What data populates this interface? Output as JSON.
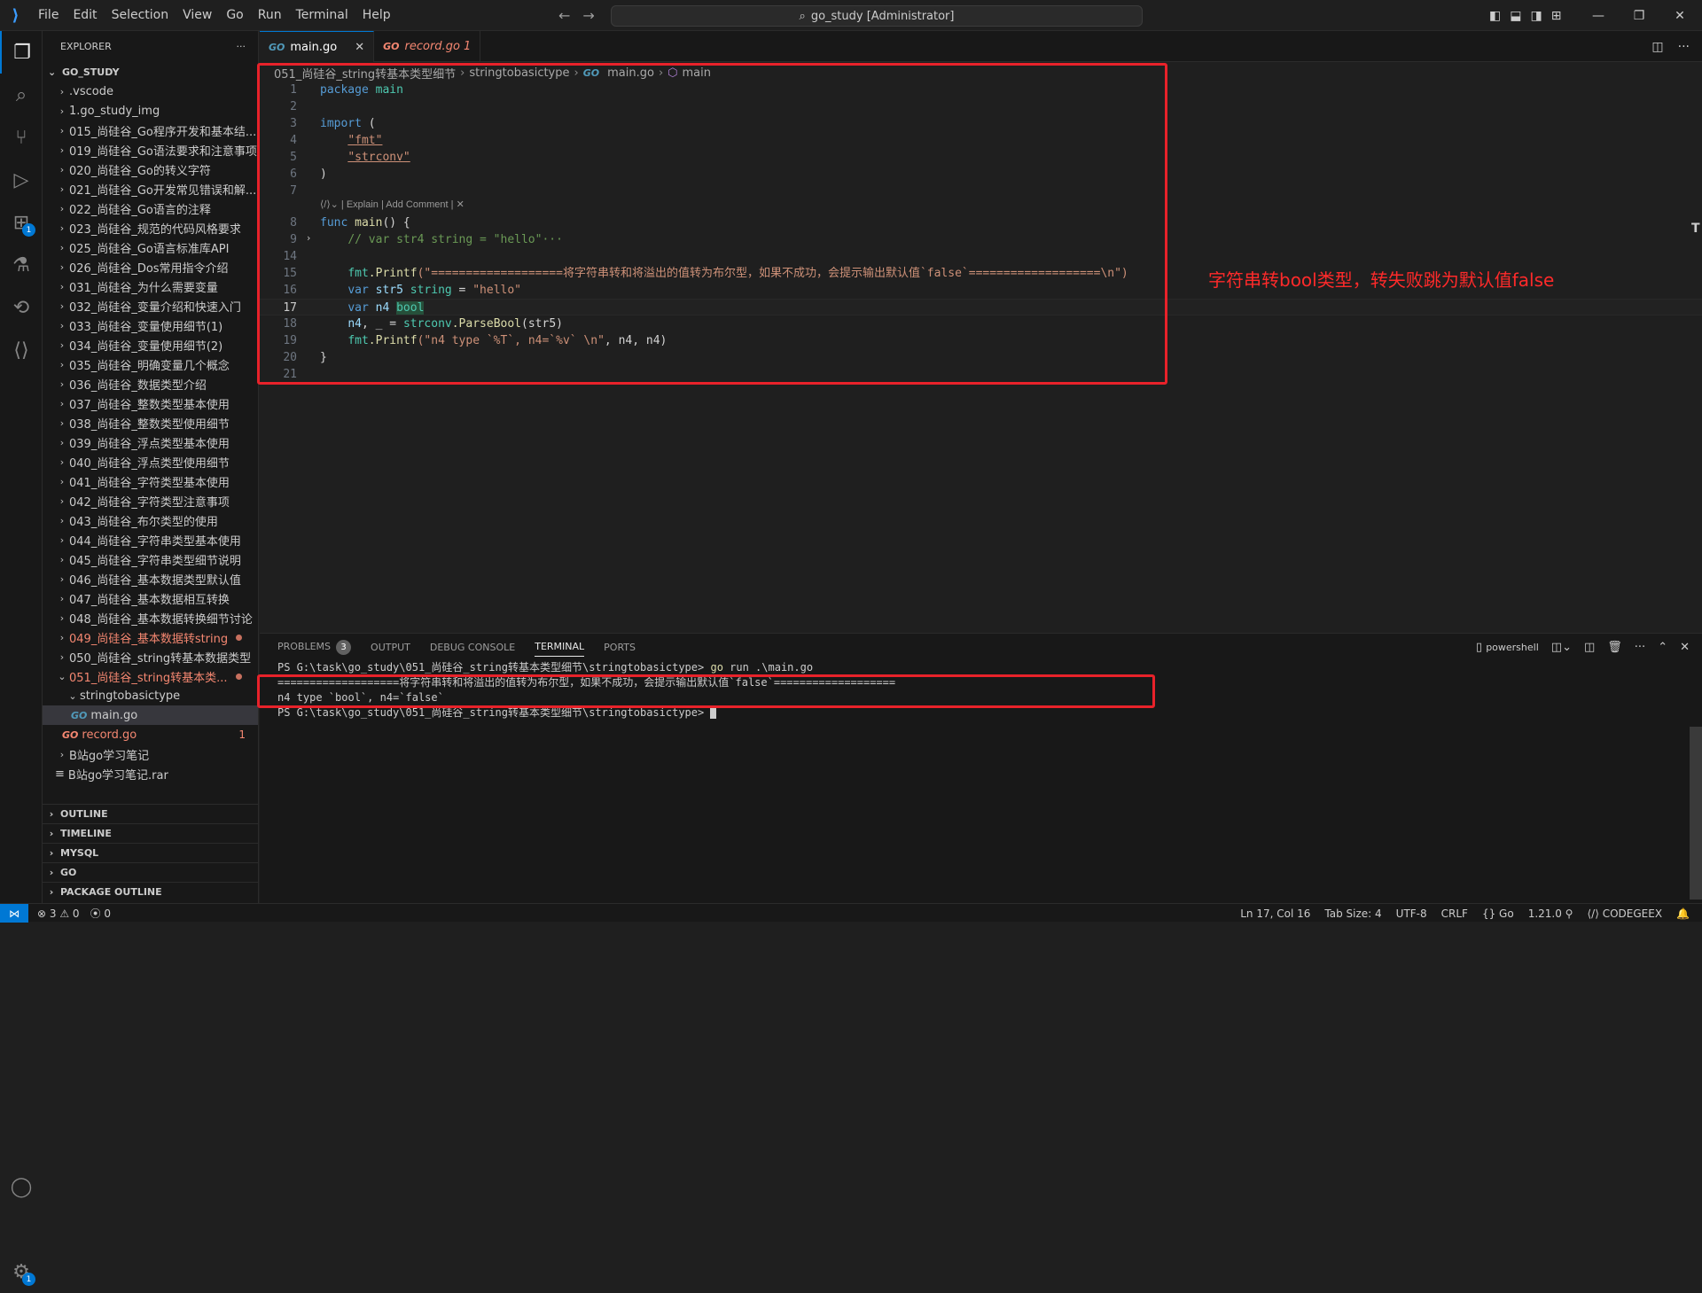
{
  "titlebar": {
    "menu": [
      "File",
      "Edit",
      "Selection",
      "View",
      "Go",
      "Run",
      "Terminal",
      "Help"
    ],
    "command_center": "go_study [Administrator]"
  },
  "activitybar": {
    "extensions_badge": "1",
    "settings_badge": "1"
  },
  "explorer": {
    "header": "EXPLORER",
    "root": "GO_STUDY",
    "items": [
      {
        "label": ".vscode",
        "type": "folder"
      },
      {
        "label": "1.go_study_img",
        "type": "folder"
      },
      {
        "label": "015_尚硅谷_Go程序开发和基本结...",
        "type": "folder"
      },
      {
        "label": "019_尚硅谷_Go语法要求和注意事项",
        "type": "folder"
      },
      {
        "label": "020_尚硅谷_Go的转义字符",
        "type": "folder"
      },
      {
        "label": "021_尚硅谷_Go开发常见错误和解...",
        "type": "folder"
      },
      {
        "label": "022_尚硅谷_Go语言的注释",
        "type": "folder"
      },
      {
        "label": "023_尚硅谷_规范的代码风格要求",
        "type": "folder"
      },
      {
        "label": "025_尚硅谷_Go语言标准库API",
        "type": "folder"
      },
      {
        "label": "026_尚硅谷_Dos常用指令介绍",
        "type": "folder"
      },
      {
        "label": "031_尚硅谷_为什么需要变量",
        "type": "folder"
      },
      {
        "label": "032_尚硅谷_变量介绍和快速入门",
        "type": "folder"
      },
      {
        "label": "033_尚硅谷_变量使用细节(1)",
        "type": "folder"
      },
      {
        "label": "034_尚硅谷_变量使用细节(2)",
        "type": "folder"
      },
      {
        "label": "035_尚硅谷_明确变量几个概念",
        "type": "folder"
      },
      {
        "label": "036_尚硅谷_数据类型介绍",
        "type": "folder"
      },
      {
        "label": "037_尚硅谷_整数类型基本使用",
        "type": "folder"
      },
      {
        "label": "038_尚硅谷_整数类型使用细节",
        "type": "folder"
      },
      {
        "label": "039_尚硅谷_浮点类型基本使用",
        "type": "folder"
      },
      {
        "label": "040_尚硅谷_浮点类型使用细节",
        "type": "folder"
      },
      {
        "label": "041_尚硅谷_字符类型基本使用",
        "type": "folder"
      },
      {
        "label": "042_尚硅谷_字符类型注意事项",
        "type": "folder"
      },
      {
        "label": "043_尚硅谷_布尔类型的使用",
        "type": "folder"
      },
      {
        "label": "044_尚硅谷_字符串类型基本使用",
        "type": "folder"
      },
      {
        "label": "045_尚硅谷_字符串类型细节说明",
        "type": "folder"
      },
      {
        "label": "046_尚硅谷_基本数据类型默认值",
        "type": "folder"
      },
      {
        "label": "047_尚硅谷_基本数据相互转换",
        "type": "folder"
      },
      {
        "label": "048_尚硅谷_基本数据转换细节讨论",
        "type": "folder"
      },
      {
        "label": "049_尚硅谷_基本数据转string",
        "type": "folder-error"
      },
      {
        "label": "050_尚硅谷_string转基本数据类型",
        "type": "folder"
      },
      {
        "label": "051_尚硅谷_string转基本类...",
        "type": "folder-error-open"
      }
    ],
    "subfolder": "stringtobasictype",
    "main_file": "main.go",
    "record_file": "record.go",
    "record_errors": "1",
    "bili_folder": "B站go学习笔记",
    "rar_file": "B站go学习笔记.rar",
    "sections": [
      "OUTLINE",
      "TIMELINE",
      "MYSQL",
      "GO",
      "PACKAGE OUTLINE"
    ]
  },
  "tabs": [
    {
      "label": "main.go",
      "active": true
    },
    {
      "label": "record.go 1",
      "active": false
    }
  ],
  "breadcrumb": {
    "folder": "051_尚硅谷_string转基本类型细节",
    "sub": "stringtobasictype",
    "file": "main.go",
    "symbol": "main"
  },
  "code": {
    "codelens": "| Explain | Add Comment |",
    "current_line": 17,
    "lines": [
      {
        "n": "1"
      },
      {
        "n": "2"
      },
      {
        "n": "3"
      },
      {
        "n": "4"
      },
      {
        "n": "5"
      },
      {
        "n": "6"
      },
      {
        "n": "7"
      },
      {
        "n": "8"
      },
      {
        "n": "9"
      },
      {
        "n": "14"
      },
      {
        "n": "15"
      },
      {
        "n": "16"
      },
      {
        "n": "17"
      },
      {
        "n": "18"
      },
      {
        "n": "19"
      },
      {
        "n": "20"
      },
      {
        "n": "21"
      }
    ],
    "t": {
      "package": "package",
      "main": "main",
      "import": "import",
      "lparen": " (",
      "fmt": "\"fmt\"",
      "strconv": "\"strconv\"",
      "rparen": ")",
      "func": "func",
      "main_sig": " main",
      "sig_rest": "() {",
      "comment9": "// var str4 string = \"hello\"···",
      "fmt15a": "fmt",
      "printf15": ".Printf",
      "str15": "(\"===================将字符串转和将溢出的值转为布尔型，如果不成功，会提示输出默认值`false`===================\\n\")",
      "var": "var",
      "str5": " str5 ",
      "string": "string",
      "eq16": " = ",
      "hello": "\"hello\"",
      "n4": " n4 ",
      "bool": "bool",
      "n4_18": "n4",
      "rest18a": ", _ = ",
      "strconv18": "strconv",
      "parse18": ".ParseBool",
      "arg18": "(str5)",
      "fmt19": "fmt",
      "printf19": ".Printf",
      "str19": "(\"n4 type `%T`, n4=`%v` \\n\"",
      "rest19": ", n4, n4)",
      "close20": "}"
    }
  },
  "annotation": "字符串转bool类型，转失败跳为默认值false",
  "panel": {
    "tabs": [
      "PROBLEMS",
      "OUTPUT",
      "DEBUG CONSOLE",
      "TERMINAL",
      "PORTS"
    ],
    "problems_count": "3",
    "shell": "powershell",
    "terminal": {
      "line1_prompt": "PS G:\\task\\go_study\\051_尚硅谷_string转基本类型细节\\stringtobasictype> ",
      "line1_cmd": "go",
      "line1_rest": " run .\\main.go",
      "line2": "===================将字符串转和将溢出的值转为布尔型，如果不成功，会提示输出默认值`false`===================",
      "line3": "n4 type `bool`, n4=`false`",
      "line4": "PS G:\\task\\go_study\\051_尚硅谷_string转基本类型细节\\stringtobasictype> "
    }
  },
  "statusbar": {
    "errors": "3",
    "warnings": "0",
    "ports": "0",
    "position": "Ln 17, Col 16",
    "tab_size": "Tab Size: 4",
    "encoding": "UTF-8",
    "eol": "CRLF",
    "language": "Go",
    "go_version": "1.21.0",
    "codegeex": "CODEGEEX"
  }
}
